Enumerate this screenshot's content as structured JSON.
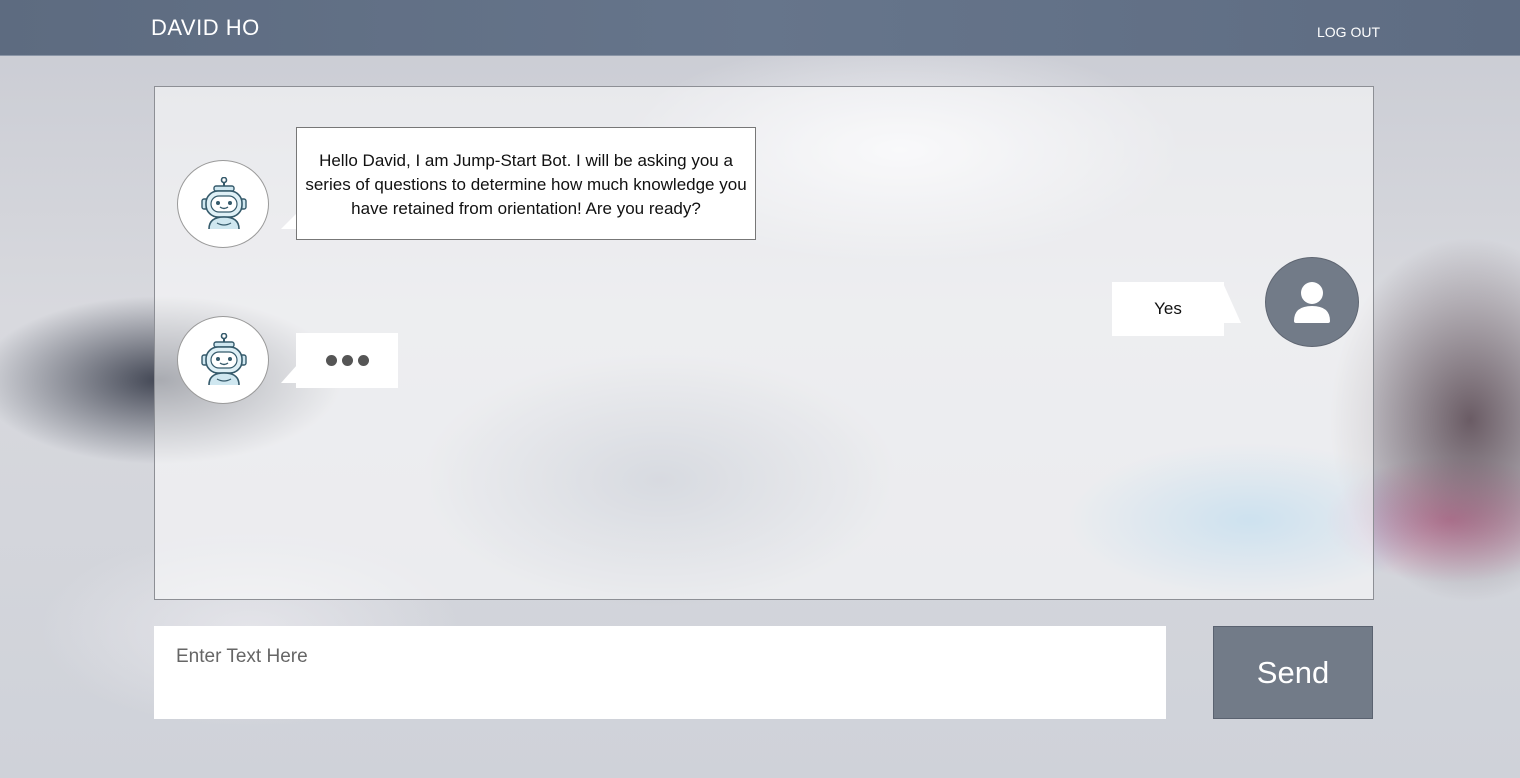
{
  "header": {
    "user_name": "DAVID HO",
    "logout_label": "LOG OUT"
  },
  "chat": {
    "messages": [
      {
        "sender": "bot",
        "text": "Hello David, I am Jump-Start Bot. I will be asking you a series of questions to determine how much knowledge you have retained from orientation! Are you ready?"
      },
      {
        "sender": "user",
        "text": "Yes"
      },
      {
        "sender": "bot",
        "typing": true
      }
    ]
  },
  "composer": {
    "placeholder": "Enter Text Here",
    "send_label": "Send"
  },
  "icons": {
    "bot": "robot-icon",
    "user": "user-icon",
    "typing": "ellipsis-icon"
  },
  "colors": {
    "header_bg": "#66758b",
    "send_bg": "#727b88",
    "user_avatar_bg": "#727b88"
  }
}
